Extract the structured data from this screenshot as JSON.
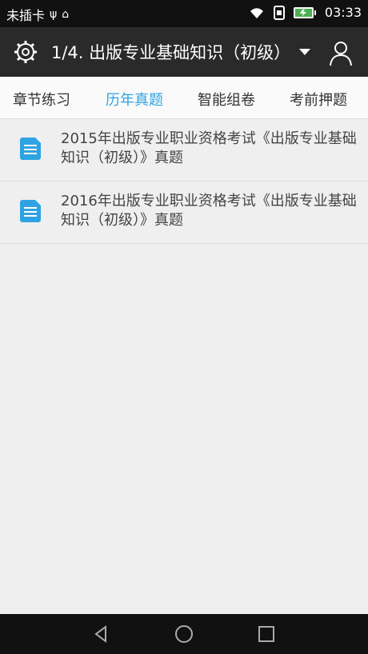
{
  "status": {
    "left_text": "未插卡",
    "time": "03:33"
  },
  "appbar": {
    "title": "1/4. 出版专业基础知识（初级）"
  },
  "tabs": [
    {
      "label": "章节练习"
    },
    {
      "label": "历年真题"
    },
    {
      "label": "智能组卷"
    },
    {
      "label": "考前押题"
    }
  ],
  "items": [
    {
      "text": "2015年出版专业职业资格考试《出版专业基础知识（初级）》真题"
    },
    {
      "text": "2016年出版专业职业资格考试《出版专业基础知识（初级）》真题"
    }
  ],
  "colors": {
    "accent": "#2ea3e3",
    "appbar": "#2a2a2a",
    "statusbar": "#111111"
  },
  "icons": [
    "settings-icon",
    "dropdown-icon",
    "user-icon",
    "document-icon",
    "back-icon",
    "home-icon",
    "recent-apps-icon",
    "usb-icon",
    "android-icon",
    "wifi-icon",
    "sim-icon",
    "battery-icon"
  ]
}
